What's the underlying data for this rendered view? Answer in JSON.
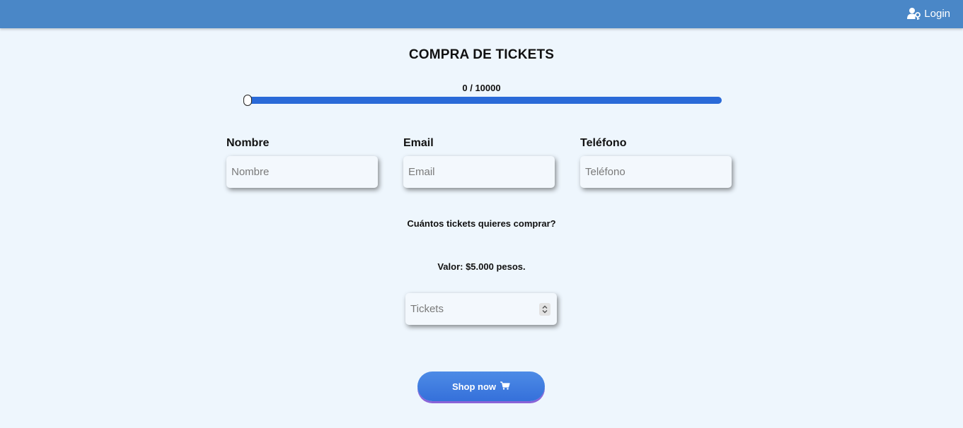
{
  "header": {
    "login_label": "Login",
    "login_icon": "user-key-icon"
  },
  "page": {
    "title": "COMPRA DE TICKETS",
    "counter_text": "0 / 10000",
    "slider": {
      "value": 0,
      "max": 10000
    }
  },
  "form": {
    "name_label": "Nombre",
    "name_placeholder": "Nombre",
    "email_label": "Email",
    "email_placeholder": "Email",
    "phone_label": "Teléfono",
    "phone_placeholder": "Teléfono",
    "question": "Cuántos tickets quieres comprar?",
    "price_text": "Valor: $5.000 pesos.",
    "tickets_placeholder": "Tickets"
  },
  "actions": {
    "shop_label": "Shop now",
    "shop_icon": "cart-icon"
  },
  "colors": {
    "topbar": "#4a87c7",
    "background": "#eef6fd",
    "accent": "#2a6ad8",
    "button_shadow": "#8a63d8"
  }
}
